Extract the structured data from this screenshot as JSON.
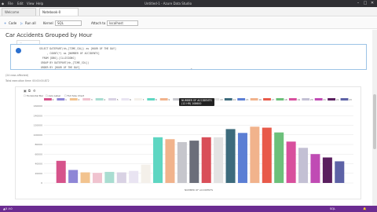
{
  "window": {
    "title": "Untitled-1 - Azure Data Studio",
    "menu": [
      "File",
      "Edit",
      "View",
      "Help"
    ]
  },
  "tabs": [
    {
      "label": "Welcome"
    },
    {
      "label": "Notebook-0"
    }
  ],
  "toolbar": {
    "cell_label": "Code",
    "run_all_label": "Run all",
    "kernel_label": "Kernel",
    "kernel_value": "SQL",
    "attach_label": "Attach to",
    "attach_value": "localhost"
  },
  "document": {
    "title": "Car Accidents Grouped by Hour"
  },
  "code_cell": {
    "lines": [
      "SELECT DATEPART(hh,[TIME_COL]) as [HOUR OF THE DAY]",
      "     , COUNT(*) as [NUMBER OF ACCIDENTS]",
      "  FROM [DBO].[CLLISIONS]",
      " GROUP BY DATEPART(hh,[TIME_COL])",
      " ORDER BY [HOUR OF THE DAY]"
    ]
  },
  "results": {
    "rows_label": "(24 rows affected)",
    "time_label": "Total execution time: 00:00:00.872"
  },
  "chart_toolbar": {
    "icons": [
      "save-image-icon",
      "copy-icon",
      "settings-icon"
    ],
    "toggles": [
      "Horizontal Bar",
      "Axis Label",
      "Full Size Chart"
    ]
  },
  "tooltip": {
    "title": "NUMBER OF ACCIDENTS",
    "value": "(12 HR) 108600"
  },
  "colors": {
    "statusbar": "#6b2c91",
    "titlebar": "#2f2f33"
  },
  "chart_data": {
    "type": "bar",
    "xlabel": "NUMBER OF ACCIDENTS",
    "ylabel": "",
    "ylim": [
      0,
      160000
    ],
    "y_ticks": [
      "0",
      "20000",
      "40000",
      "60000",
      "80000",
      "100000",
      "120000",
      "140000",
      "160000"
    ],
    "categories": [
      "0",
      "1",
      "2",
      "3",
      "4",
      "5",
      "6",
      "7",
      "8",
      "9",
      "10",
      "11",
      "12",
      "13",
      "14",
      "15",
      "16",
      "17",
      "18",
      "19",
      "20",
      "21",
      "22",
      "23"
    ],
    "values": [
      46000,
      27000,
      22000,
      21000,
      23000,
      22000,
      25000,
      38000,
      95000,
      91000,
      85000,
      88000,
      95000,
      95000,
      112000,
      104000,
      117000,
      115000,
      105000,
      86000,
      73000,
      60000,
      53000,
      45000
    ],
    "colors": [
      "#d6538b",
      "#8e86d6",
      "#f2c38f",
      "#f0c3cf",
      "#a9ddd1",
      "#d9d2e4",
      "#e9e4f2",
      "#f4f0ea",
      "#5ed6c2",
      "#f1b38c",
      "#c6c6cc",
      "#6b6e7a",
      "#d94f59",
      "#e3e3e3",
      "#3d6b7c",
      "#5b7ed4",
      "#f1b38c",
      "#e85a4a",
      "#6cc07a",
      "#d84f9d",
      "#c3c0d4",
      "#c04bb4",
      "#5a1f5f",
      "#5d62a6"
    ],
    "grid": true,
    "legend": "top"
  }
}
